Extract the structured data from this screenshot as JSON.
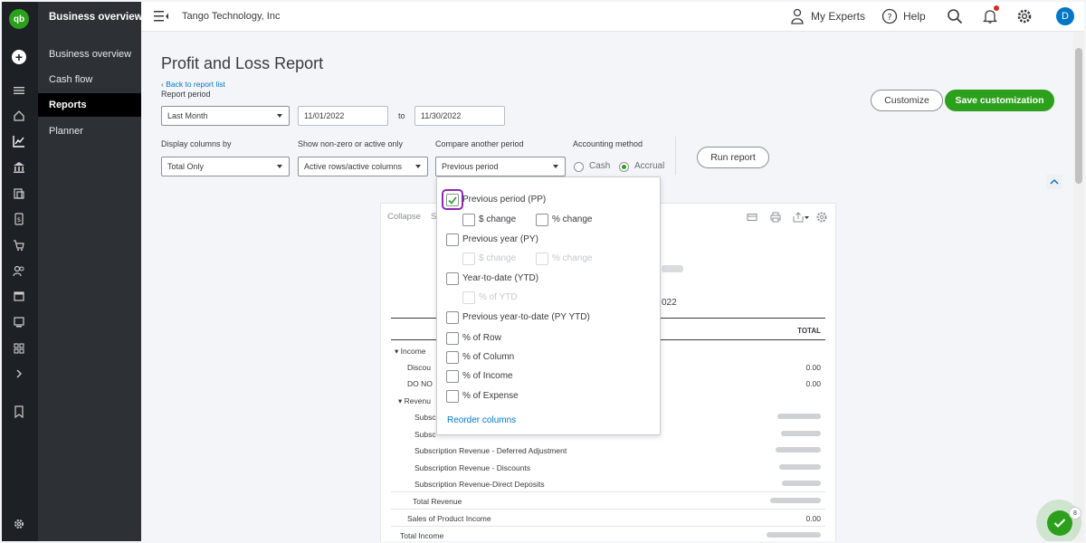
{
  "nav": {
    "logo": "qb",
    "menu_title": "Business overview",
    "items": [
      {
        "label": "Business overview"
      },
      {
        "label": "Cash flow"
      },
      {
        "label": "Reports"
      },
      {
        "label": "Planner"
      }
    ]
  },
  "topbar": {
    "company": "Tango Technology, Inc",
    "my_experts": "My Experts",
    "help": "Help",
    "avatar": "D"
  },
  "page": {
    "title": "Profit and Loss Report",
    "back_link": "Back to report list",
    "report_period_label": "Report period",
    "report_period_value": "Last Month",
    "date_from": "11/01/2022",
    "to": "to",
    "date_to": "11/30/2022",
    "display_columns_label": "Display columns by",
    "display_columns_value": "Total Only",
    "show_nonzero_label": "Show non-zero or active only",
    "show_nonzero_value": "Active rows/active columns",
    "compare_label": "Compare another period",
    "compare_value": "Previous period",
    "accounting_label": "Accounting method",
    "cash": "Cash",
    "accrual": "Accrual",
    "accounting_selected": "Accrual",
    "run_report": "Run report",
    "customize": "Customize",
    "save_customization": "Save customization"
  },
  "report": {
    "toolbar_collapse": "Collapse",
    "toolbar_sort": "S",
    "date_fragment": "022",
    "total_header": "TOTAL",
    "rows": [
      {
        "label": "Income",
        "value": ""
      },
      {
        "label": "Discou",
        "value": "0.00"
      },
      {
        "label": "DO NO",
        "value": "0.00"
      },
      {
        "label": "Revenu",
        "value": ""
      },
      {
        "label": "Subsc",
        "value": ""
      },
      {
        "label": "Subsc",
        "value": ""
      },
      {
        "label": "Subscription Revenue - Deferred Adjustment",
        "value": ""
      },
      {
        "label": "Subscription Revenue - Discounts",
        "value": ""
      },
      {
        "label": "Subscription Revenue-Direct Deposits",
        "value": ""
      },
      {
        "label": "Total Revenue",
        "value": ""
      },
      {
        "label": "Sales of Product Income",
        "value": "0.00"
      },
      {
        "label": "Total Income",
        "value": ""
      }
    ]
  },
  "compare_menu": {
    "options": [
      {
        "label": "Previous period (PP)",
        "checked": true
      },
      {
        "label": "$ change",
        "checked": false
      },
      {
        "label": "% change",
        "checked": false
      },
      {
        "label": "Previous year (PY)",
        "checked": false
      },
      {
        "label": "$ change",
        "checked": false,
        "disabled": true
      },
      {
        "label": "% change",
        "checked": false,
        "disabled": true
      },
      {
        "label": "Year-to-date (YTD)",
        "checked": false
      },
      {
        "label": "% of YTD",
        "checked": false,
        "disabled": true
      },
      {
        "label": "Previous year-to-date (PY YTD)",
        "checked": false
      },
      {
        "label": "% of Row",
        "checked": false
      },
      {
        "label": "% of Column",
        "checked": false
      },
      {
        "label": "% of Income",
        "checked": false
      },
      {
        "label": "% of Expense",
        "checked": false
      }
    ],
    "reorder": "Reorder columns"
  },
  "assistant": {
    "badge": "8"
  },
  "colors": {
    "brand_green": "#2ca01c",
    "link_blue": "#0077c5",
    "focus_purple": "#8d2ab0"
  }
}
